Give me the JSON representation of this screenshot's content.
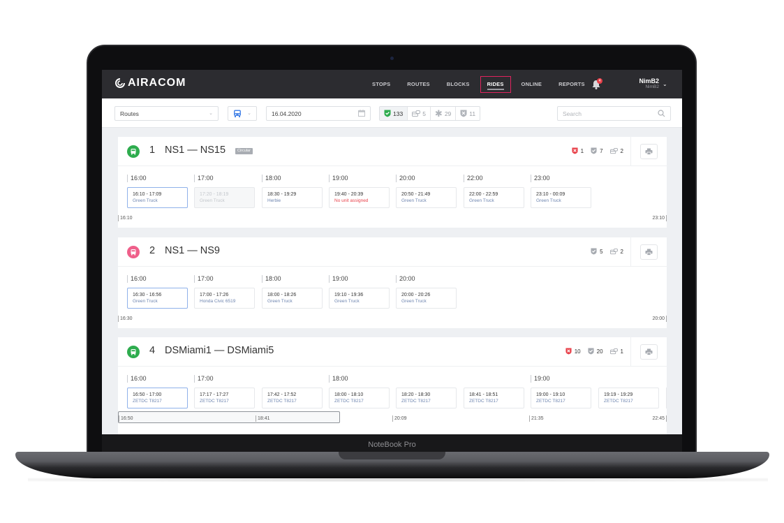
{
  "device": {
    "label": "NoteBook Pro"
  },
  "app": {
    "brand": "AIRACOM"
  },
  "nav": {
    "items": [
      {
        "label": "STOPS"
      },
      {
        "label": "ROUTES"
      },
      {
        "label": "BLOCKS"
      },
      {
        "label": "RIDES",
        "active": true
      },
      {
        "label": "ONLINE"
      },
      {
        "label": "REPORTS"
      }
    ],
    "notifications_badge": "4",
    "user": {
      "name": "NimB2",
      "sub": "NimB2"
    }
  },
  "filters": {
    "view_select": "Routes",
    "date": "16.04.2020",
    "stats": [
      {
        "icon": "shield-check-icon",
        "value": "133",
        "active": true
      },
      {
        "icon": "bus-chat-icon",
        "value": "5"
      },
      {
        "icon": "asterisk-icon",
        "value": "29"
      },
      {
        "icon": "shield-x-icon",
        "value": "11"
      }
    ],
    "search_placeholder": "Search"
  },
  "colors": {
    "accent_active_nav": "#e0245e",
    "route_green": "#2eac4e",
    "route_pink": "#ef5f8a",
    "warning": "#e8414a",
    "selected_ride_border": "#8fb1ea"
  },
  "routes": [
    {
      "number": "1",
      "name": "NS1 — NS15",
      "tag": "Circular",
      "status": "green",
      "stats": {
        "failed": "1",
        "checked": "7",
        "buses": "2"
      },
      "hours": [
        "16:00",
        "17:00",
        "18:00",
        "19:00",
        "20:00",
        "22:00",
        "23:00"
      ],
      "rides": [
        {
          "time": "16:10 - 17:09",
          "unit": "Green Truck",
          "state": "selected"
        },
        {
          "time": "17:20 - 18:19",
          "unit": "Green Truck",
          "state": "dim"
        },
        {
          "time": "18:30 - 19:29",
          "unit": "Herbie"
        },
        {
          "time": "19:40 - 20:39",
          "unit": "No unit assigned",
          "state": "warn"
        },
        {
          "time": "20:50 - 21:49",
          "unit": "Green Truck"
        },
        {
          "time": "22:00 - 22:59",
          "unit": "Green Truck"
        },
        {
          "time": "23:10 - 00:09",
          "unit": "Green Truck"
        }
      ],
      "axis": {
        "start": "16:10",
        "end": "23:10"
      }
    },
    {
      "number": "2",
      "name": "NS1 — NS9",
      "status": "pink",
      "stats": {
        "checked": "5",
        "buses": "2"
      },
      "hours": [
        "16:00",
        "17:00",
        "18:00",
        "19:00",
        "20:00"
      ],
      "rides": [
        {
          "time": "16:30 - 16:56",
          "unit": "Green Truck",
          "state": "selected"
        },
        {
          "time": "17:00 - 17:26",
          "unit": "Honda Civic 6519"
        },
        {
          "time": "18:00 - 18:26",
          "unit": "Green Truck"
        },
        {
          "time": "19:10 - 19:36",
          "unit": "Green Truck"
        },
        {
          "time": "20:00 - 20:26",
          "unit": "Green Truck"
        }
      ],
      "axis": {
        "start": "16:30",
        "end": "20:00"
      }
    },
    {
      "number": "4",
      "name": "DSMiami1 — DSMiami5",
      "status": "green",
      "stats": {
        "failed": "10",
        "checked": "20",
        "buses": "1"
      },
      "hours": [
        "16:00",
        "17:00",
        "18:00",
        "19:00"
      ],
      "rides": [
        {
          "time": "16:50 - 17:00",
          "unit": "ZETDC T8217",
          "state": "selected"
        },
        {
          "time": "17:17 - 17:27",
          "unit": "ZETDC T8217"
        },
        {
          "time": "17:42 - 17:52",
          "unit": "ZETDC T8217"
        },
        {
          "time": "18:00 - 18:10",
          "unit": "ZETDC T8217"
        },
        {
          "time": "18:20 - 18:30",
          "unit": "ZETDC T8217"
        },
        {
          "time": "18:41 - 18:51",
          "unit": "ZETDC T8217"
        },
        {
          "time": "19:00 - 19:10",
          "unit": "ZETDC T8217"
        },
        {
          "time": "19:19 - 19:29",
          "unit": "ZETDC T8217"
        }
      ],
      "axis": {
        "ticks": [
          "16:50",
          "18:41",
          "20:09",
          "21:35",
          "22:45"
        ]
      }
    }
  ]
}
